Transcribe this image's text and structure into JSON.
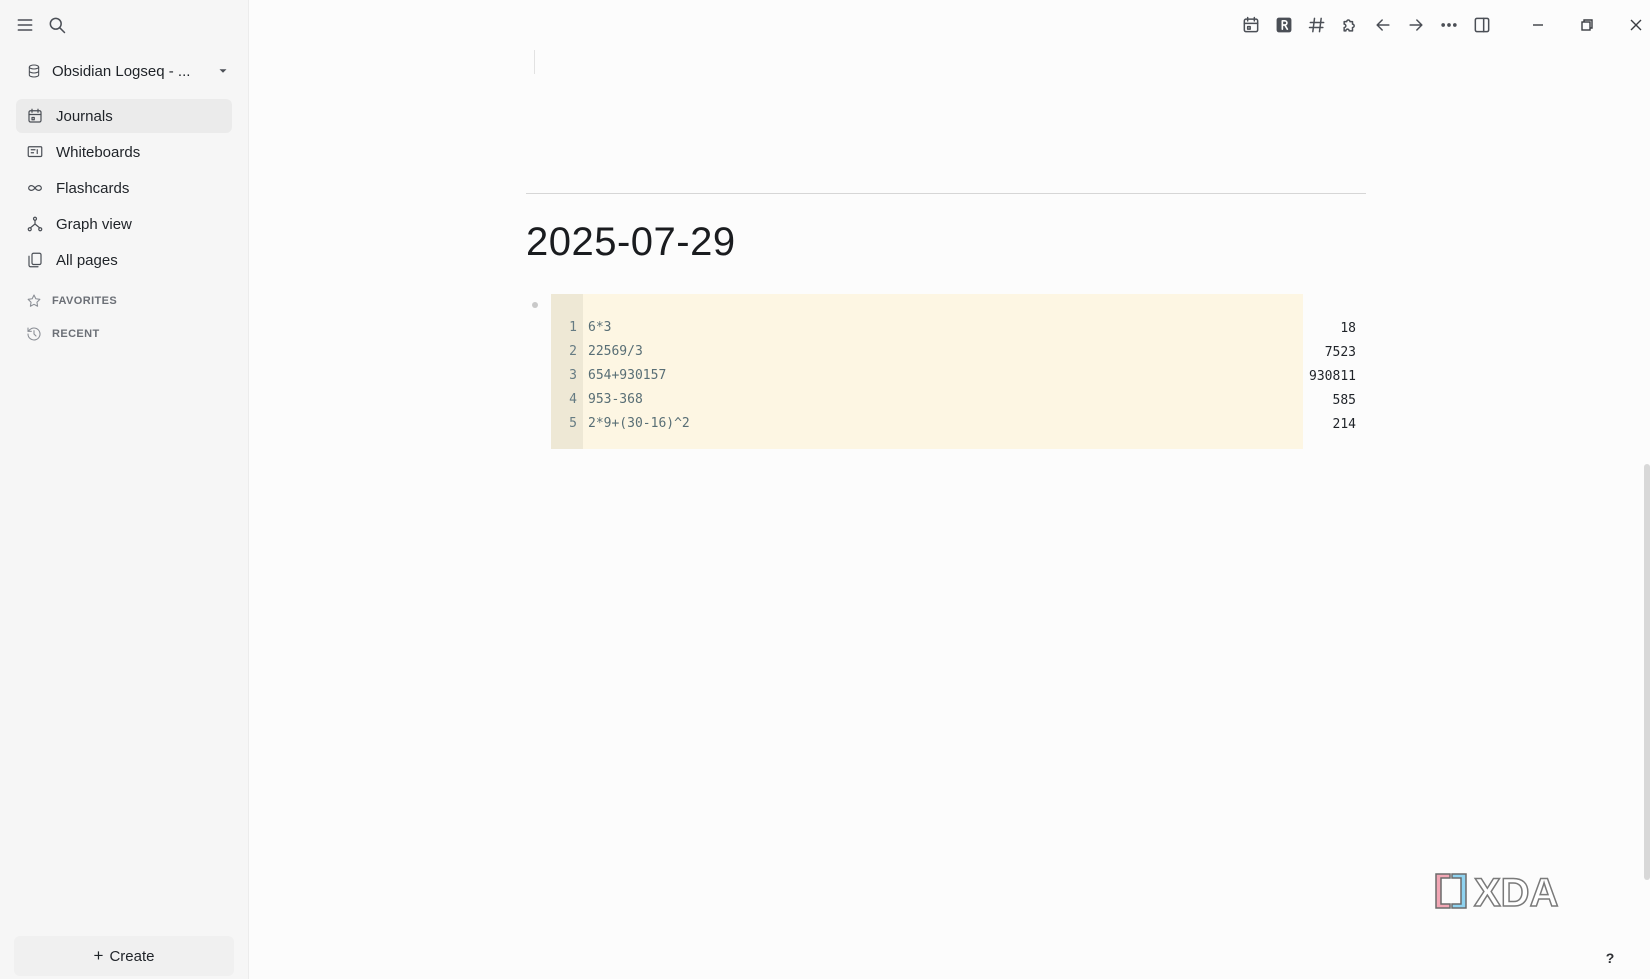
{
  "sidebar": {
    "graph_name": "Obsidian Logseq - ...",
    "nav_items": [
      {
        "label": "Journals",
        "icon": "calendar-icon",
        "active": true
      },
      {
        "label": "Whiteboards",
        "icon": "whiteboard-icon",
        "active": false
      },
      {
        "label": "Flashcards",
        "icon": "infinity-icon",
        "active": false
      },
      {
        "label": "Graph view",
        "icon": "graph-icon",
        "active": false
      },
      {
        "label": "All pages",
        "icon": "pages-icon",
        "active": false
      }
    ],
    "favorites_label": "FAVORITES",
    "recent_label": "RECENT",
    "create_label": "Create"
  },
  "toolbar": {
    "icons": [
      "calendar-icon",
      "r-icon",
      "hashtag-icon",
      "puzzle-icon",
      "arrow-left-icon",
      "arrow-right-icon",
      "more-icon",
      "sidebar-toggle-icon"
    ],
    "window_controls": [
      "minimize-icon",
      "restore-icon",
      "close-icon"
    ]
  },
  "page": {
    "title": "2025-07-29",
    "code_lines": [
      {
        "num": "1",
        "text": "6*3"
      },
      {
        "num": "2",
        "text": "22569/3"
      },
      {
        "num": "3",
        "text": "654+930157"
      },
      {
        "num": "4",
        "text": "953-368"
      },
      {
        "num": "5",
        "text": "2*9+(30-16)^2"
      }
    ],
    "results": [
      "18",
      "7523",
      "930811",
      "585",
      "214"
    ]
  },
  "watermark": "XDA",
  "help_label": "?",
  "colors": {
    "code_bg": "#fdf6e3",
    "gutter_bg": "#eee8d5",
    "sidebar_bg": "#f6f6f6"
  }
}
